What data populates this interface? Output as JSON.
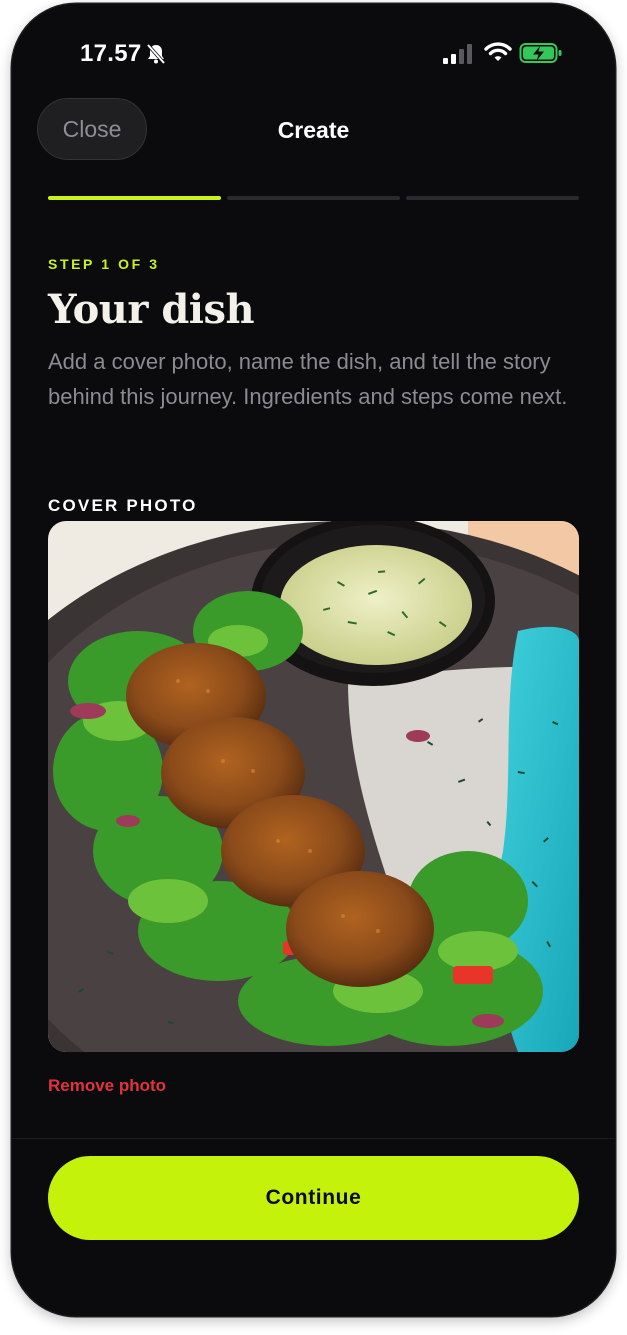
{
  "status_bar": {
    "time": "17.57"
  },
  "nav": {
    "close_label": "Close",
    "title": "Create"
  },
  "progress": {
    "current_step": 1,
    "total_steps": 3
  },
  "step_label": "STEP 1 OF 3",
  "heading": "Your dish",
  "description": "Add a cover photo, name the dish, and tell the story behind this journey. Ingredients and steps come next.",
  "cover_photo": {
    "label": "COVER PHOTO",
    "remove_label": "Remove photo"
  },
  "continue_label": "Continue",
  "colors": {
    "accent": "#c4f20a",
    "danger": "#e0333d",
    "background": "#0b0b0d"
  },
  "icons": [
    "bell-slash-icon",
    "cellular-signal-icon",
    "wifi-icon",
    "battery-charging-icon"
  ]
}
